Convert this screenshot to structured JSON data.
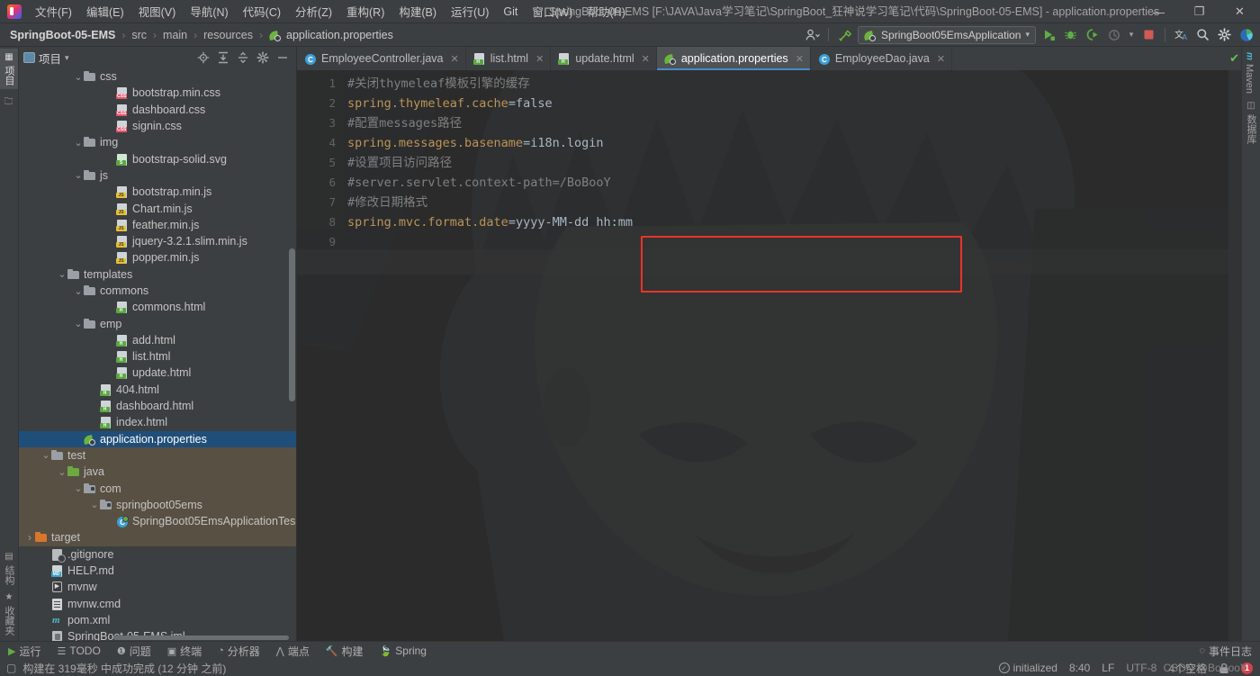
{
  "window": {
    "title": "SpringBoot-05-EMS [F:\\JAVA\\Java学习笔记\\SpringBoot_狂神说学习笔记\\代码\\SpringBoot-05-EMS] - application.properties",
    "minimize": "—",
    "maximize": "❐",
    "close": "✕"
  },
  "menubar": {
    "items": [
      {
        "label": "文件(F)"
      },
      {
        "label": "编辑(E)"
      },
      {
        "label": "视图(V)"
      },
      {
        "label": "导航(N)"
      },
      {
        "label": "代码(C)"
      },
      {
        "label": "分析(Z)"
      },
      {
        "label": "重构(R)"
      },
      {
        "label": "构建(B)"
      },
      {
        "label": "运行(U)"
      },
      {
        "label": "Git"
      },
      {
        "label": "窗口(W)"
      },
      {
        "label": "帮助(H)"
      }
    ]
  },
  "breadcrumb": {
    "items": [
      "SpringBoot-05-EMS",
      "src",
      "main",
      "resources",
      "application.properties"
    ],
    "separator": "›"
  },
  "toolbar": {
    "run_configuration": "SpringBoot05EmsApplication",
    "dropdown_caret": "▾",
    "icons": [
      {
        "name": "user-settings-icon",
        "glyph": "👤"
      },
      {
        "name": "build-hammer-icon",
        "glyph": "🔨"
      },
      {
        "name": "run-icon",
        "glyph": "▶"
      },
      {
        "name": "debug-icon",
        "glyph": "🐞"
      },
      {
        "name": "run-coverage-icon",
        "glyph": "▶"
      },
      {
        "name": "profiler-icon",
        "glyph": "◔"
      },
      {
        "name": "stop-icon",
        "glyph": "■"
      },
      {
        "name": "translate-icon",
        "glyph": "文A"
      },
      {
        "name": "search-everywhere-icon",
        "glyph": "🔍"
      },
      {
        "name": "settings-gear-icon",
        "glyph": "⚙"
      },
      {
        "name": "ide-feature-icon",
        "glyph": "▶"
      }
    ]
  },
  "left_rail": {
    "top": [
      {
        "label": "项目",
        "name": "rail-project"
      },
      {
        "label": "",
        "name": "rail-structure-folder"
      }
    ],
    "bottom": [
      {
        "label": "结构",
        "name": "rail-structure"
      },
      {
        "label": "收藏夹",
        "name": "rail-favorites"
      }
    ]
  },
  "right_rail": {
    "items": [
      {
        "label": "Maven",
        "name": "rail-maven"
      },
      {
        "label": "数据库",
        "name": "rail-database"
      }
    ]
  },
  "project_panel": {
    "title": "项目",
    "dropdown_caret": "▾",
    "actions": [
      {
        "name": "locate-file-icon",
        "glyph": "⊕"
      },
      {
        "name": "expand-all-icon",
        "glyph": "⇟"
      },
      {
        "name": "collapse-all-icon",
        "glyph": "⇡"
      },
      {
        "name": "panel-settings-icon",
        "glyph": "⚙"
      },
      {
        "name": "hide-panel-icon",
        "glyph": "—"
      }
    ],
    "tree": [
      {
        "label": "css",
        "indent": 4,
        "arrow": "v",
        "icon": "folder",
        "kind": "dir"
      },
      {
        "label": "bootstrap.min.css",
        "indent": 6,
        "arrow": "",
        "icon": "css",
        "kind": "file"
      },
      {
        "label": "dashboard.css",
        "indent": 6,
        "arrow": "",
        "icon": "css",
        "kind": "file"
      },
      {
        "label": "signin.css",
        "indent": 6,
        "arrow": "",
        "icon": "css",
        "kind": "file"
      },
      {
        "label": "img",
        "indent": 4,
        "arrow": "v",
        "icon": "folder",
        "kind": "dir"
      },
      {
        "label": "bootstrap-solid.svg",
        "indent": 6,
        "arrow": "",
        "icon": "svg",
        "kind": "file"
      },
      {
        "label": "js",
        "indent": 4,
        "arrow": "v",
        "icon": "folder",
        "kind": "dir"
      },
      {
        "label": "bootstrap.min.js",
        "indent": 6,
        "arrow": "",
        "icon": "js",
        "kind": "file"
      },
      {
        "label": "Chart.min.js",
        "indent": 6,
        "arrow": "",
        "icon": "js",
        "kind": "file"
      },
      {
        "label": "feather.min.js",
        "indent": 6,
        "arrow": "",
        "icon": "js",
        "kind": "file"
      },
      {
        "label": "jquery-3.2.1.slim.min.js",
        "indent": 6,
        "arrow": "",
        "icon": "js",
        "kind": "file"
      },
      {
        "label": "popper.min.js",
        "indent": 6,
        "arrow": "",
        "icon": "js",
        "kind": "file"
      },
      {
        "label": "templates",
        "indent": 3,
        "arrow": "v",
        "icon": "folder",
        "kind": "dir"
      },
      {
        "label": "commons",
        "indent": 4,
        "arrow": "v",
        "icon": "folder",
        "kind": "dir"
      },
      {
        "label": "commons.html",
        "indent": 6,
        "arrow": "",
        "icon": "html",
        "kind": "file"
      },
      {
        "label": "emp",
        "indent": 4,
        "arrow": "v",
        "icon": "folder",
        "kind": "dir"
      },
      {
        "label": "add.html",
        "indent": 6,
        "arrow": "",
        "icon": "html",
        "kind": "file"
      },
      {
        "label": "list.html",
        "indent": 6,
        "arrow": "",
        "icon": "html",
        "kind": "file"
      },
      {
        "label": "update.html",
        "indent": 6,
        "arrow": "",
        "icon": "html",
        "kind": "file"
      },
      {
        "label": "404.html",
        "indent": 5,
        "arrow": "",
        "icon": "html",
        "kind": "file"
      },
      {
        "label": "dashboard.html",
        "indent": 5,
        "arrow": "",
        "icon": "html",
        "kind": "file"
      },
      {
        "label": "index.html",
        "indent": 5,
        "arrow": "",
        "icon": "html",
        "kind": "file"
      },
      {
        "label": "application.properties",
        "indent": 4,
        "arrow": "",
        "icon": "props",
        "kind": "file",
        "state": "selected"
      },
      {
        "label": "test",
        "indent": 2,
        "arrow": "v",
        "icon": "folder",
        "kind": "dir",
        "state": "hl"
      },
      {
        "label": "java",
        "indent": 3,
        "arrow": "v",
        "icon": "folder-green",
        "kind": "dir",
        "state": "hl"
      },
      {
        "label": "com",
        "indent": 4,
        "arrow": "v",
        "icon": "package",
        "kind": "dir",
        "state": "hl"
      },
      {
        "label": "springboot05ems",
        "indent": 5,
        "arrow": "v",
        "icon": "package",
        "kind": "dir",
        "state": "hl"
      },
      {
        "label": "SpringBoot05EmsApplicationTes",
        "indent": 6,
        "arrow": "",
        "icon": "javatest",
        "kind": "file",
        "state": "hl"
      },
      {
        "label": "target",
        "indent": 1,
        "arrow": ">",
        "icon": "folder-orange",
        "kind": "dir",
        "state": "hl"
      },
      {
        "label": ".gitignore",
        "indent": 2,
        "arrow": "",
        "icon": "git",
        "kind": "file"
      },
      {
        "label": "HELP.md",
        "indent": 2,
        "arrow": "",
        "icon": "md",
        "kind": "file"
      },
      {
        "label": "mvnw",
        "indent": 2,
        "arrow": "",
        "icon": "exe",
        "kind": "file"
      },
      {
        "label": "mvnw.cmd",
        "indent": 2,
        "arrow": "",
        "icon": "cmd",
        "kind": "file"
      },
      {
        "label": "pom.xml",
        "indent": 2,
        "arrow": "",
        "icon": "maven",
        "kind": "file"
      },
      {
        "label": "SpringBoot-05-EMS.iml",
        "indent": 2,
        "arrow": "",
        "icon": "iml",
        "kind": "file"
      }
    ]
  },
  "editor": {
    "tabs": [
      {
        "label": "EmployeeController.java",
        "icon": "java-class-icon",
        "active": false,
        "close": "✕"
      },
      {
        "label": "list.html",
        "icon": "html-icon",
        "active": false,
        "close": "✕"
      },
      {
        "label": "update.html",
        "icon": "html-icon",
        "active": false,
        "close": "✕"
      },
      {
        "label": "application.properties",
        "icon": "spring-properties-icon",
        "active": true,
        "close": "✕"
      },
      {
        "label": "EmployeeDao.java",
        "icon": "java-class-icon",
        "active": false,
        "close": "✕"
      }
    ],
    "line_numbers": [
      "1",
      "2",
      "3",
      "4",
      "5",
      "6",
      "7",
      "8",
      "9"
    ],
    "lines": [
      {
        "n": 1,
        "type": "comment",
        "text": "#关闭thymeleaf模板引擎的缓存"
      },
      {
        "n": 2,
        "type": "property",
        "key": "spring.thymeleaf.cache",
        "eq": "=",
        "value": "false"
      },
      {
        "n": 3,
        "type": "comment",
        "text": "#配置messages路径"
      },
      {
        "n": 4,
        "type": "property",
        "key": "spring.messages.basename",
        "eq": "=",
        "value": "i18n.login"
      },
      {
        "n": 5,
        "type": "comment",
        "text": "#设置项目访问路径"
      },
      {
        "n": 6,
        "type": "comment",
        "text": "#server.servlet.context-path=/BoBooY"
      },
      {
        "n": 7,
        "type": "comment",
        "text": "#修改日期格式"
      },
      {
        "n": 8,
        "type": "property",
        "key": "spring.mvc.format.date",
        "eq": "=",
        "value": "yyyy-MM-dd hh:mm"
      },
      {
        "n": 9,
        "type": "blank",
        "text": ""
      }
    ],
    "inspection_status": "✔",
    "annotation_color": "#e8342a"
  },
  "toolwindows": {
    "items": [
      {
        "label": "运行",
        "name": "run",
        "glyph": "▶"
      },
      {
        "label": "TODO",
        "name": "todo",
        "glyph": "☰"
      },
      {
        "label": "问题",
        "name": "problems",
        "glyph": "❶"
      },
      {
        "label": "终端",
        "name": "terminal",
        "glyph": "▣"
      },
      {
        "label": "分析器",
        "name": "profiler",
        "glyph": "◔"
      },
      {
        "label": "端点",
        "name": "endpoints",
        "glyph": "⋀"
      },
      {
        "label": "构建",
        "name": "build",
        "glyph": "🔨"
      },
      {
        "label": "Spring",
        "name": "spring",
        "glyph": "🍃"
      }
    ],
    "event_log": "事件日志"
  },
  "statusbar": {
    "build_message": "构建在 319毫秒 中成功完成 (12 分钟 之前)",
    "build_icon": "▢",
    "initialized": "initialized",
    "time": "8:40",
    "line_separator": "LF",
    "encoding": "UTF-8",
    "indent": "4个空格",
    "lock_icon": "🔒",
    "notifications": "1"
  },
  "watermark": {
    "text": "CSDN @BoBooY"
  },
  "colors": {
    "accent_blue": "#4a88c7",
    "selection_blue": "#1f4e79",
    "annotation_red": "#e8342a",
    "panel_bg": "#3c3f41",
    "editor_bg": "#2b2b2b",
    "comment_gray": "#808080",
    "key_orange": "#bc9458",
    "ok_green": "#62c554"
  }
}
